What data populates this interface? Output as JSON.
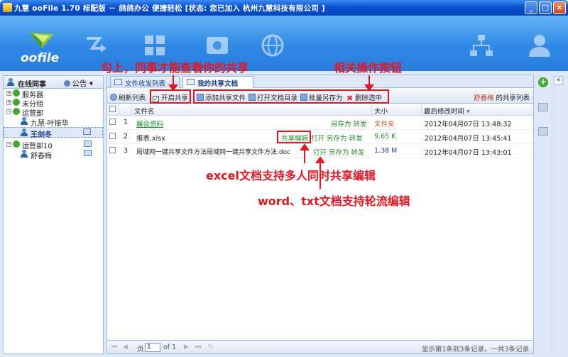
{
  "window": {
    "title": "九慧 ooFile 1.70 标配版 － 鸽鸽办公 便捷轻松 [状态: 您已加入 杭州九慧科技有限公司 ]",
    "min": "_",
    "max": "□",
    "close": "×"
  },
  "banner": {
    "logo": "oofile"
  },
  "sidebar": {
    "title": "在线同事",
    "announce": "公告",
    "items": [
      {
        "label": "服务器",
        "level": 0
      },
      {
        "label": "未分组",
        "level": 0
      },
      {
        "label": "运营部",
        "level": 0
      },
      {
        "label": "九慧-叶振华",
        "level": 1
      },
      {
        "label": "王剑冬",
        "level": 1
      },
      {
        "label": "运营部10",
        "level": 0
      },
      {
        "label": "舒春梅",
        "level": 1
      }
    ]
  },
  "tabs": [
    {
      "label": "文件收发列表"
    },
    {
      "label": "我的共享文档"
    }
  ],
  "toolbar": {
    "refresh": "刷新列表",
    "enable_share": "开启共享",
    "add": "添加共享文件",
    "open_dir": "打开文档目录",
    "batch": "批量另存为",
    "delete": "删除选中",
    "owner_name": "舒春梅",
    "owner_suffix": "的共享列表"
  },
  "grid": {
    "col_name": "文件名",
    "col_size": "大小",
    "col_date": "最后修改时间",
    "rows": [
      {
        "n": "1",
        "name": "展会资料",
        "actions": [
          "另存为",
          "转发"
        ],
        "size": "文件夹",
        "date": "2012年04月07日 13:48:32"
      },
      {
        "n": "2",
        "name": "报表.xlsx",
        "actions": [
          "共享编辑",
          "打开",
          "另存为",
          "转发"
        ],
        "size": "9.65 K",
        "date": "2012年04月07日 13:45:41"
      },
      {
        "n": "3",
        "name": "局域网一键共享文件方法局域网一键共享文件方法.doc",
        "actions": [
          "打开",
          "另存为",
          "转发"
        ],
        "size": "1.38 M",
        "date": "2012年04月07日 13:43:01"
      }
    ]
  },
  "pager": {
    "page_label": "页",
    "page": "1",
    "of": "of 1",
    "summary": "显示第1条到3条记录，一共3条记录"
  },
  "annotations": {
    "check_note": "勾上，同事才能查看你的共享",
    "ops_note": "相关操作按钮",
    "excel_note": "excel文档支持多人同时共享编辑",
    "word_note": "word、txt文档支持轮流编辑"
  },
  "colors": {
    "accent": "#3089e6",
    "annotation": "#e8141f",
    "link_green": "#2a8a2a"
  }
}
